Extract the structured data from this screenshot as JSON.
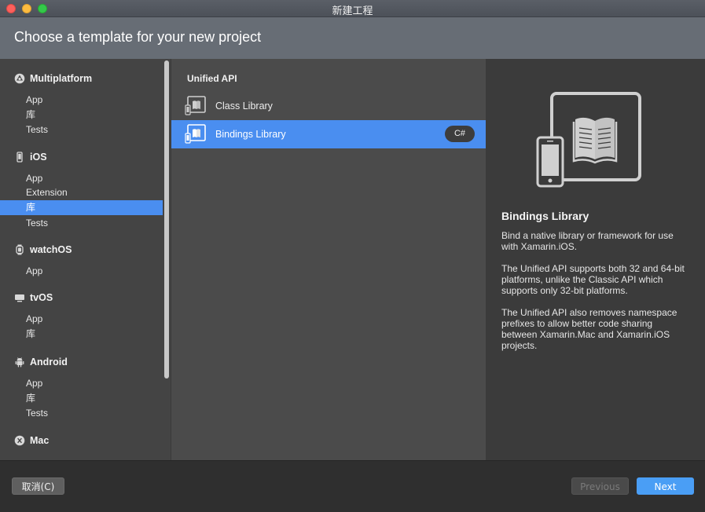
{
  "window": {
    "title": "新建工程"
  },
  "header": {
    "title": "Choose a template for your new project"
  },
  "sidebar": {
    "categories": [
      {
        "label": "Multiplatform",
        "icon": "multiplatform-icon",
        "items": [
          "App",
          "库",
          "Tests"
        ]
      },
      {
        "label": "iOS",
        "icon": "iphone-icon",
        "items": [
          "App",
          "Extension",
          "库",
          "Tests"
        ],
        "selected": "库"
      },
      {
        "label": "watchOS",
        "icon": "watch-icon",
        "items": [
          "App"
        ]
      },
      {
        "label": "tvOS",
        "icon": "tv-icon",
        "items": [
          "App",
          "库"
        ]
      },
      {
        "label": "Android",
        "icon": "android-icon",
        "items": [
          "App",
          "库",
          "Tests"
        ]
      },
      {
        "label": "Mac",
        "icon": "mac-x-icon",
        "items": []
      }
    ]
  },
  "templates": {
    "section_title": "Unified API",
    "items": [
      {
        "label": "Class Library",
        "icon": "class-library-icon"
      },
      {
        "label": "Bindings Library",
        "icon": "bindings-library-icon",
        "selected": true,
        "language": "C#"
      }
    ]
  },
  "detail": {
    "title": "Bindings Library",
    "paragraphs": [
      "Bind a native library or framework for use with Xamarin.iOS.",
      "The Unified API supports both 32 and 64-bit platforms, unlike the Classic API which supports only 32-bit platforms.",
      "The Unified API also removes namespace prefixes to allow better code sharing between Xamarin.Mac and Xamarin.iOS projects."
    ]
  },
  "footer": {
    "cancel": "取消(C)",
    "previous": "Previous",
    "next": "Next"
  },
  "colors": {
    "accent": "#4a8ef0",
    "next_button": "#4a9ef5"
  }
}
